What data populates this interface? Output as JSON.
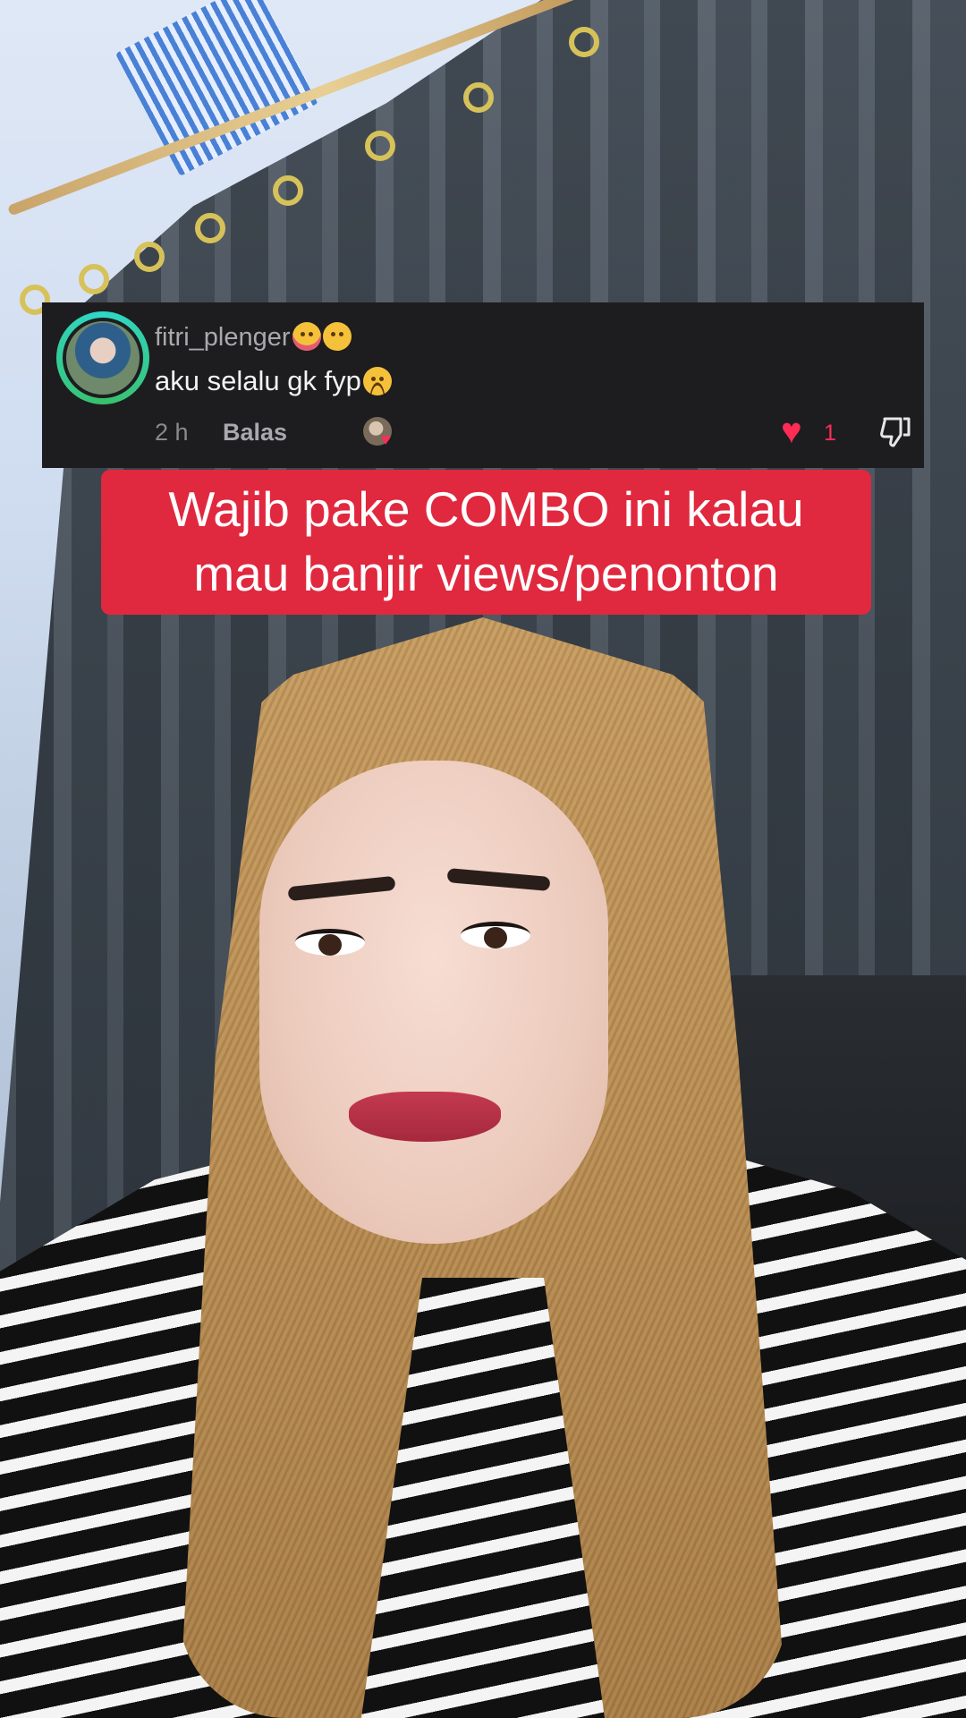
{
  "comment": {
    "username": "fitri_plenger",
    "username_emojis": [
      "squinting-tongue-emoji",
      "hand-over-mouth-emoji"
    ],
    "text": "aku selalu gk fyp",
    "text_emoji": "frowning-face-emoji",
    "time": "2 h",
    "reply_label": "Balas",
    "like_count": "1"
  },
  "caption": {
    "line1": "Wajib pake COMBO ini kalau",
    "line2": "mau banjir views/penonton"
  },
  "colors": {
    "caption_bg": "#e0283e",
    "card_bg": "#1d1d1f",
    "like_color": "#fe2c55",
    "avatar_ring": "#2fd8c9"
  }
}
